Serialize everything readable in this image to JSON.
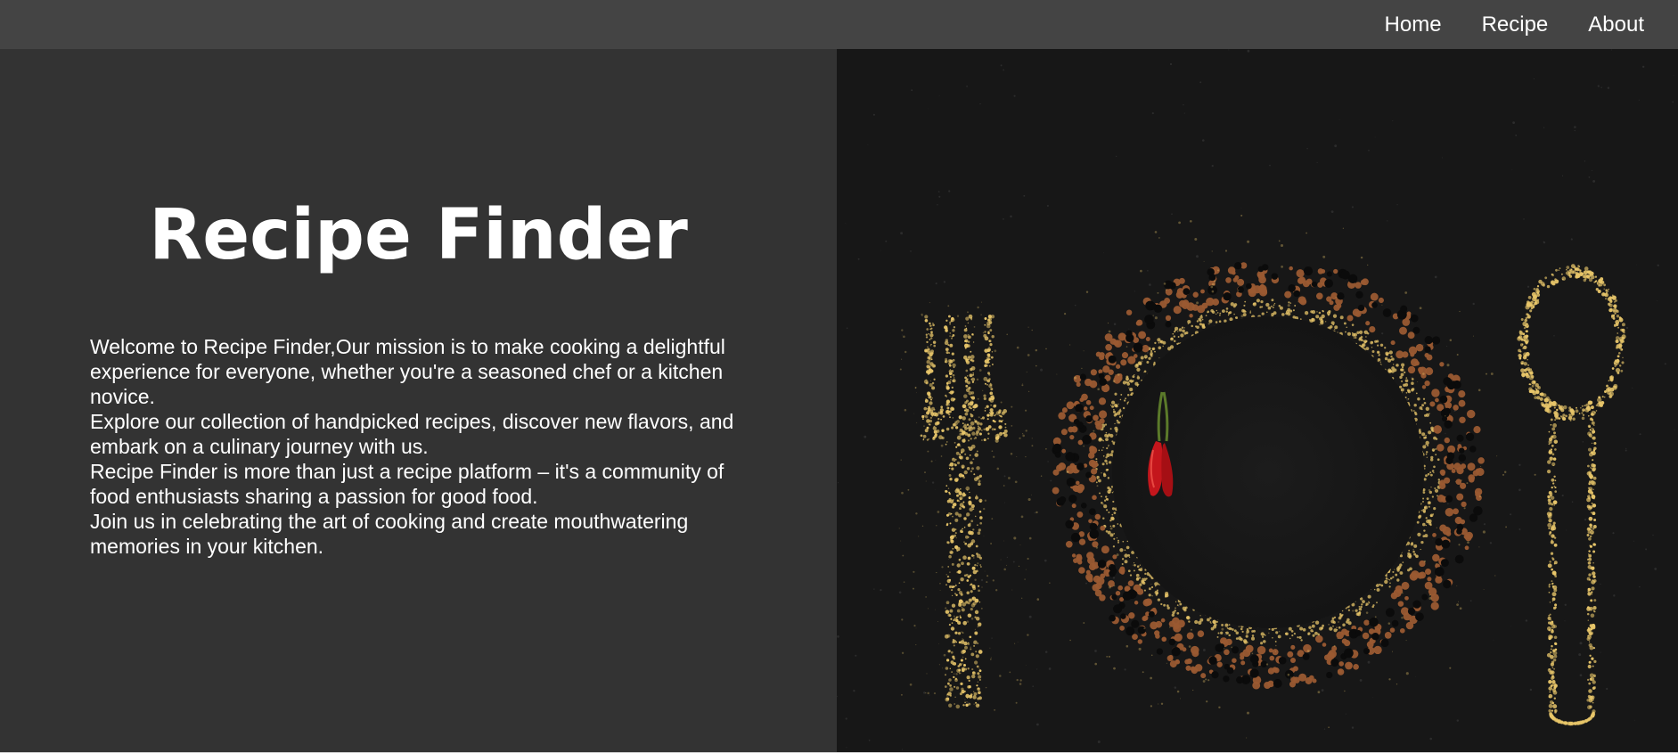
{
  "nav": {
    "links": [
      {
        "label": "Home"
      },
      {
        "label": "Recipe"
      },
      {
        "label": "About"
      }
    ]
  },
  "hero": {
    "title": "Recipe Finder",
    "paragraphs": [
      "Welcome to Recipe Finder,Our mission is to make cooking a delightful experience for everyone, whether you're a seasoned chef or a kitchen novice.",
      "Explore our collection of handpicked recipes, discover new flavors, and embark on a culinary journey with us.",
      "Recipe Finder is more than just a recipe platform – it's a community of food enthusiasts sharing a passion for good food.",
      "Join us in celebrating the art of cooking and create mouthwatering memories in your kitchen."
    ]
  },
  "colors": {
    "navbar": "#444444",
    "left_panel": "#333333",
    "text": "#ffffff",
    "photo_background": "#161616",
    "spice_yellow": "#e8c66a",
    "lentil_brown": "#9a5a32",
    "bean_black": "#0b0b0b",
    "chili_red": "#c4161c"
  },
  "image": {
    "name": "hero-food-photo",
    "subject": "plate-of-spices-with-fork-spoon-and-chili"
  }
}
